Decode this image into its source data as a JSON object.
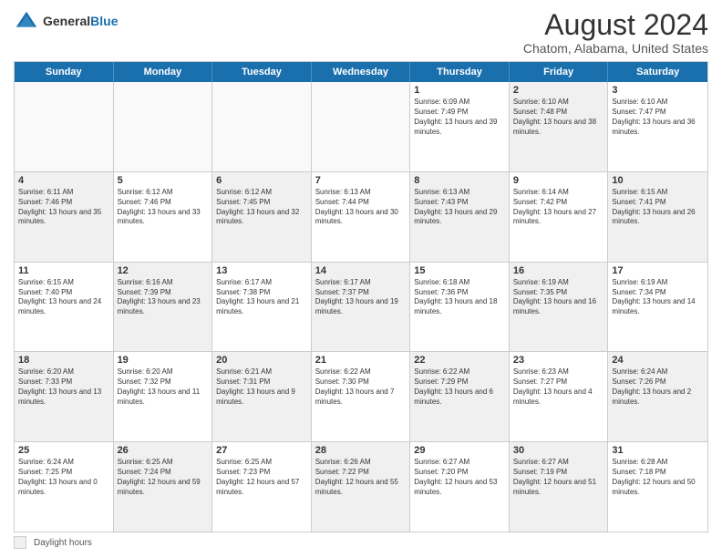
{
  "logo": {
    "general": "General",
    "blue": "Blue"
  },
  "title": "August 2024",
  "subtitle": "Chatom, Alabama, United States",
  "days_of_week": [
    "Sunday",
    "Monday",
    "Tuesday",
    "Wednesday",
    "Thursday",
    "Friday",
    "Saturday"
  ],
  "legend_label": "Daylight hours",
  "weeks": [
    [
      {
        "day": "",
        "empty": true
      },
      {
        "day": "",
        "empty": true
      },
      {
        "day": "",
        "empty": true
      },
      {
        "day": "",
        "empty": true
      },
      {
        "day": "1",
        "sunrise": "6:09 AM",
        "sunset": "7:49 PM",
        "daylight": "13 hours and 39 minutes."
      },
      {
        "day": "2",
        "sunrise": "6:10 AM",
        "sunset": "7:48 PM",
        "daylight": "13 hours and 38 minutes.",
        "shaded": true
      },
      {
        "day": "3",
        "sunrise": "6:10 AM",
        "sunset": "7:47 PM",
        "daylight": "13 hours and 36 minutes."
      }
    ],
    [
      {
        "day": "4",
        "sunrise": "6:11 AM",
        "sunset": "7:46 PM",
        "daylight": "13 hours and 35 minutes.",
        "shaded": true
      },
      {
        "day": "5",
        "sunrise": "6:12 AM",
        "sunset": "7:46 PM",
        "daylight": "13 hours and 33 minutes."
      },
      {
        "day": "6",
        "sunrise": "6:12 AM",
        "sunset": "7:45 PM",
        "daylight": "13 hours and 32 minutes.",
        "shaded": true
      },
      {
        "day": "7",
        "sunrise": "6:13 AM",
        "sunset": "7:44 PM",
        "daylight": "13 hours and 30 minutes."
      },
      {
        "day": "8",
        "sunrise": "6:13 AM",
        "sunset": "7:43 PM",
        "daylight": "13 hours and 29 minutes.",
        "shaded": true
      },
      {
        "day": "9",
        "sunrise": "6:14 AM",
        "sunset": "7:42 PM",
        "daylight": "13 hours and 27 minutes."
      },
      {
        "day": "10",
        "sunrise": "6:15 AM",
        "sunset": "7:41 PM",
        "daylight": "13 hours and 26 minutes.",
        "shaded": true
      }
    ],
    [
      {
        "day": "11",
        "sunrise": "6:15 AM",
        "sunset": "7:40 PM",
        "daylight": "13 hours and 24 minutes."
      },
      {
        "day": "12",
        "sunrise": "6:16 AM",
        "sunset": "7:39 PM",
        "daylight": "13 hours and 23 minutes.",
        "shaded": true
      },
      {
        "day": "13",
        "sunrise": "6:17 AM",
        "sunset": "7:38 PM",
        "daylight": "13 hours and 21 minutes."
      },
      {
        "day": "14",
        "sunrise": "6:17 AM",
        "sunset": "7:37 PM",
        "daylight": "13 hours and 19 minutes.",
        "shaded": true
      },
      {
        "day": "15",
        "sunrise": "6:18 AM",
        "sunset": "7:36 PM",
        "daylight": "13 hours and 18 minutes."
      },
      {
        "day": "16",
        "sunrise": "6:19 AM",
        "sunset": "7:35 PM",
        "daylight": "13 hours and 16 minutes.",
        "shaded": true
      },
      {
        "day": "17",
        "sunrise": "6:19 AM",
        "sunset": "7:34 PM",
        "daylight": "13 hours and 14 minutes."
      }
    ],
    [
      {
        "day": "18",
        "sunrise": "6:20 AM",
        "sunset": "7:33 PM",
        "daylight": "13 hours and 13 minutes.",
        "shaded": true
      },
      {
        "day": "19",
        "sunrise": "6:20 AM",
        "sunset": "7:32 PM",
        "daylight": "13 hours and 11 minutes."
      },
      {
        "day": "20",
        "sunrise": "6:21 AM",
        "sunset": "7:31 PM",
        "daylight": "13 hours and 9 minutes.",
        "shaded": true
      },
      {
        "day": "21",
        "sunrise": "6:22 AM",
        "sunset": "7:30 PM",
        "daylight": "13 hours and 7 minutes."
      },
      {
        "day": "22",
        "sunrise": "6:22 AM",
        "sunset": "7:29 PM",
        "daylight": "13 hours and 6 minutes.",
        "shaded": true
      },
      {
        "day": "23",
        "sunrise": "6:23 AM",
        "sunset": "7:27 PM",
        "daylight": "13 hours and 4 minutes."
      },
      {
        "day": "24",
        "sunrise": "6:24 AM",
        "sunset": "7:26 PM",
        "daylight": "13 hours and 2 minutes.",
        "shaded": true
      }
    ],
    [
      {
        "day": "25",
        "sunrise": "6:24 AM",
        "sunset": "7:25 PM",
        "daylight": "13 hours and 0 minutes."
      },
      {
        "day": "26",
        "sunrise": "6:25 AM",
        "sunset": "7:24 PM",
        "daylight": "12 hours and 59 minutes.",
        "shaded": true
      },
      {
        "day": "27",
        "sunrise": "6:25 AM",
        "sunset": "7:23 PM",
        "daylight": "12 hours and 57 minutes."
      },
      {
        "day": "28",
        "sunrise": "6:26 AM",
        "sunset": "7:22 PM",
        "daylight": "12 hours and 55 minutes.",
        "shaded": true
      },
      {
        "day": "29",
        "sunrise": "6:27 AM",
        "sunset": "7:20 PM",
        "daylight": "12 hours and 53 minutes."
      },
      {
        "day": "30",
        "sunrise": "6:27 AM",
        "sunset": "7:19 PM",
        "daylight": "12 hours and 51 minutes.",
        "shaded": true
      },
      {
        "day": "31",
        "sunrise": "6:28 AM",
        "sunset": "7:18 PM",
        "daylight": "12 hours and 50 minutes."
      }
    ]
  ]
}
